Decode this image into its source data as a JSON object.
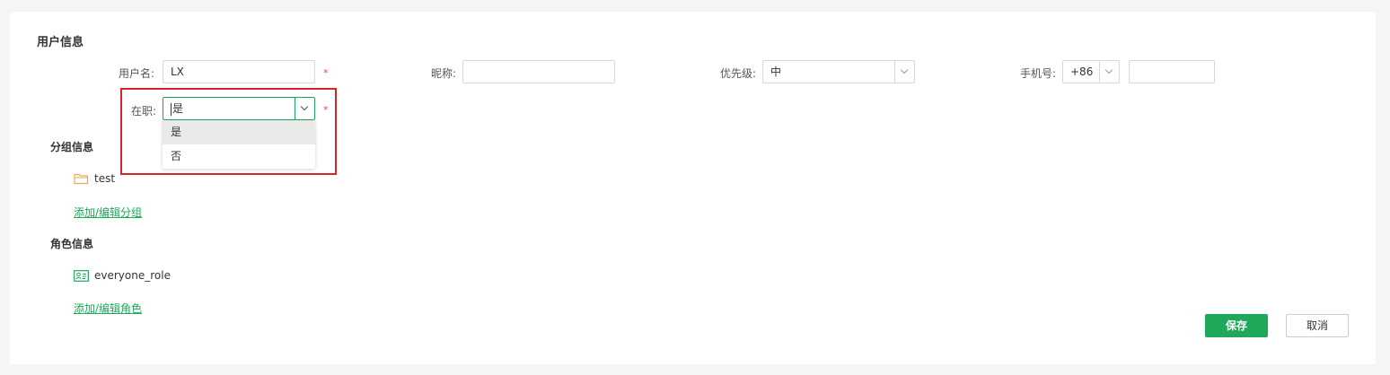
{
  "user_info": {
    "title": "用户信息",
    "username_label": "用户名:",
    "username_value": "LX",
    "required_mark": "*",
    "nickname_label": "昵称:",
    "nickname_value": "",
    "priority_label": "优先级:",
    "priority_value": "中",
    "phone_label": "手机号:",
    "phone_code": "+86",
    "phone_value": "",
    "employed_label": "在职:",
    "employed_value": "是",
    "employed_options": [
      "是",
      "否"
    ]
  },
  "group_info": {
    "title": "分组信息",
    "groups": [
      "test"
    ],
    "edit_link": "添加/编辑分组"
  },
  "role_info": {
    "title": "角色信息",
    "roles": [
      "everyone_role"
    ],
    "edit_link": "添加/编辑角色"
  },
  "actions": {
    "save_label": "保存",
    "cancel_label": "取消"
  },
  "colors": {
    "accent": "#1fa75a",
    "required": "#e34d4d",
    "folder_icon": "#f0a64a",
    "highlight_box": "#d9232a"
  }
}
